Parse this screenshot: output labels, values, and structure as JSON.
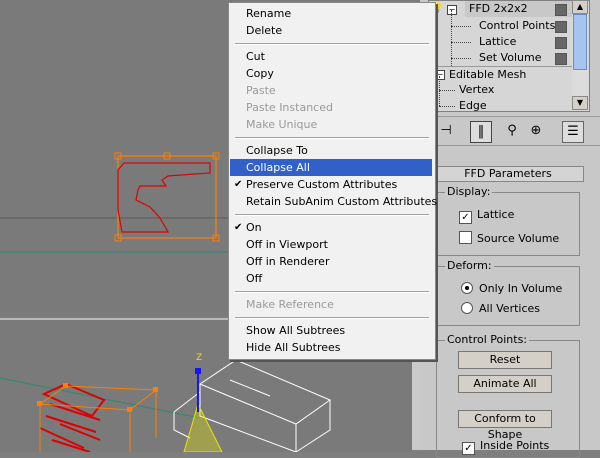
{
  "stack": {
    "items": [
      {
        "label": "FFD 2x2x2",
        "highlight": true
      },
      {
        "label": "Control Points"
      },
      {
        "label": "Lattice"
      },
      {
        "label": "Set Volume"
      },
      {
        "label": "Editable Mesh"
      },
      {
        "label": "Vertex"
      },
      {
        "label": "Edge"
      }
    ]
  },
  "menu": {
    "items": [
      {
        "label": "Rename"
      },
      {
        "label": "Delete"
      },
      {
        "label": "Cut"
      },
      {
        "label": "Copy"
      },
      {
        "label": "Paste"
      },
      {
        "label": "Paste Instanced"
      },
      {
        "label": "Make Unique"
      },
      {
        "label": "Collapse To"
      },
      {
        "label": "Collapse All"
      },
      {
        "label": "Preserve Custom Attributes"
      },
      {
        "label": "Retain SubAnim Custom Attributes"
      },
      {
        "label": "On"
      },
      {
        "label": "Off in Viewport"
      },
      {
        "label": "Off in Renderer"
      },
      {
        "label": "Off"
      },
      {
        "label": "Make Reference"
      },
      {
        "label": "Show All Subtrees"
      },
      {
        "label": "Hide All Subtrees"
      }
    ]
  },
  "panel": {
    "rollout_title": "FFD Parameters",
    "display": {
      "title": "Display:",
      "lattice": "Lattice",
      "source_volume": "Source Volume"
    },
    "deform": {
      "title": "Deform:",
      "only_in_volume": "Only In Volume",
      "all_vertices": "All Vertices"
    },
    "control_points": {
      "title": "Control Points:",
      "reset": "Reset",
      "animate_all": "Animate All",
      "conform": "Conform to Shape",
      "inside_points": "Inside Points"
    }
  },
  "viewport": {
    "axis_label": "Z"
  },
  "colors": {
    "menu_highlight": "#3160c8",
    "selection_orange": "#ff7f00",
    "wire_red": "#e00000",
    "gizmo_yellow": "#e6e600"
  }
}
